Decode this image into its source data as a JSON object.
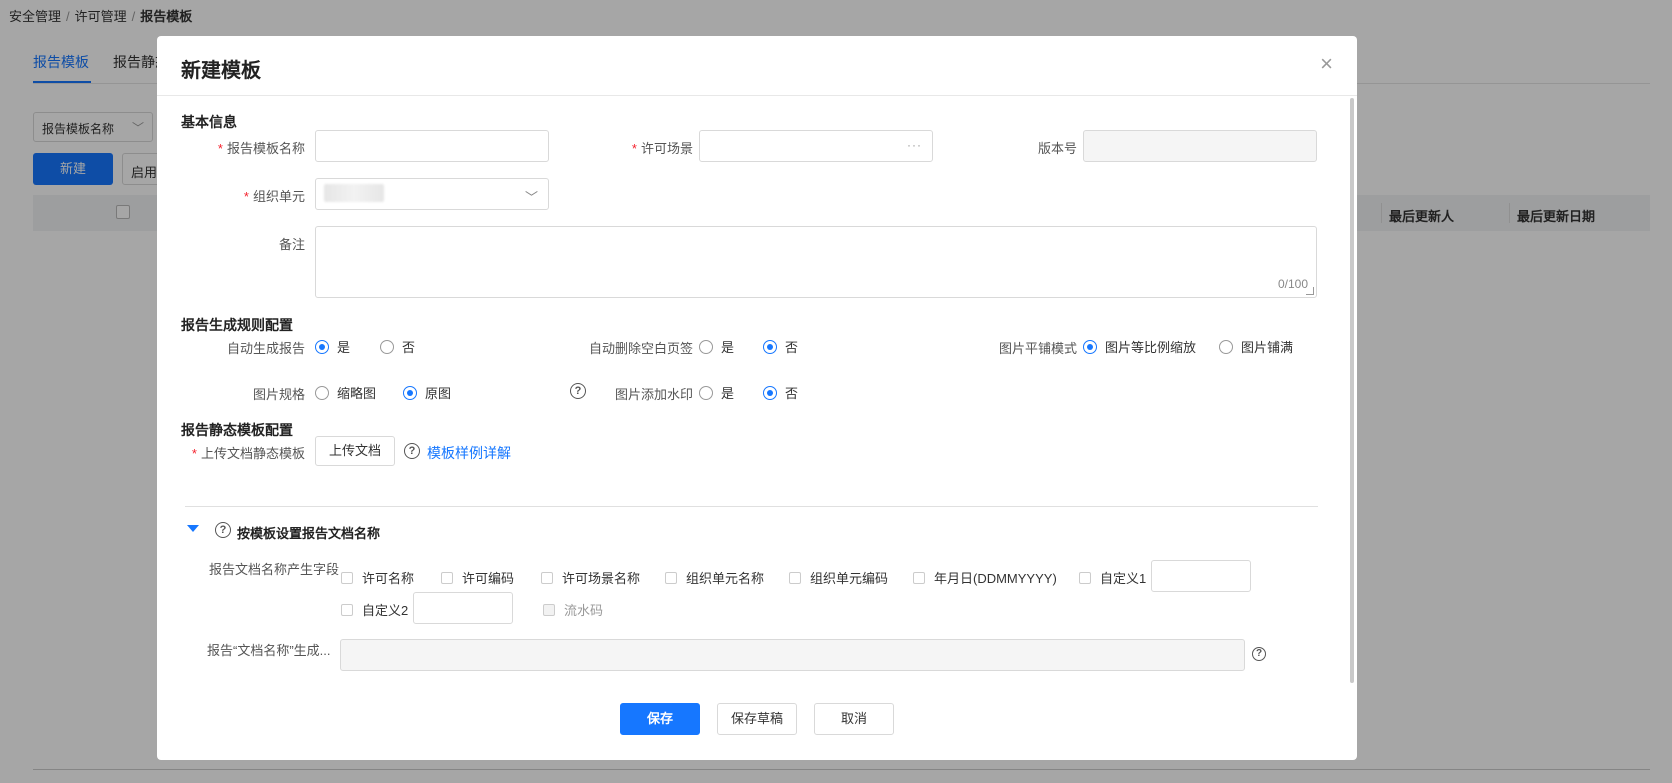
{
  "breadcrumb": [
    "安全管理",
    "许可管理",
    "报告模板"
  ],
  "tabs": [
    "报告模板",
    "报告静态"
  ],
  "background": {
    "filter_select": "报告模板名称",
    "new_button": "新建",
    "enable_button": "启用",
    "columns": [
      "最后更新人",
      "最后更新日期"
    ]
  },
  "modal": {
    "title": "新建模板",
    "close": "×",
    "basic_info": {
      "section_title": "基本信息",
      "template_name_label": "报告模板名称",
      "scene_label": "许可场景",
      "scene_dots": "···",
      "version_label": "版本号",
      "org_label": "组织单元",
      "remark_label": "备注",
      "remark_counter": "0/100",
      "required_mark": "*"
    },
    "rules": {
      "section_title": "报告生成规则配置",
      "auto_generate_label": "自动生成报告",
      "auto_delete_label": "自动删除空白页签",
      "image_mode_label": "图片平铺模式",
      "image_spec_label": "图片规格",
      "watermark_label": "图片添加水印",
      "yes": "是",
      "no": "否",
      "mode_scale": "图片等比例缩放",
      "mode_fill": "图片铺满",
      "spec_thumb": "缩略图",
      "spec_original": "原图"
    },
    "static": {
      "section_title": "报告静态模板配置",
      "upload_label": "上传文档静态模板",
      "upload_button": "上传文档",
      "help": "?",
      "sample_link": "模板样例详解"
    },
    "doc_name": {
      "section_title": "按模板设置报告文档名称",
      "fields_label": "报告文档名称产生字段",
      "fields": [
        "许可名称",
        "许可编码",
        "许可场景名称",
        "组织单元名称",
        "组织单元编码",
        "年月日(DDMMYYYY)",
        "自定义1"
      ],
      "fields_row2": [
        "自定义2"
      ],
      "serial": "流水码",
      "result_label": "报告“文档名称”生成..."
    },
    "footer": {
      "save": "保存",
      "save_draft": "保存草稿",
      "cancel": "取消"
    }
  }
}
